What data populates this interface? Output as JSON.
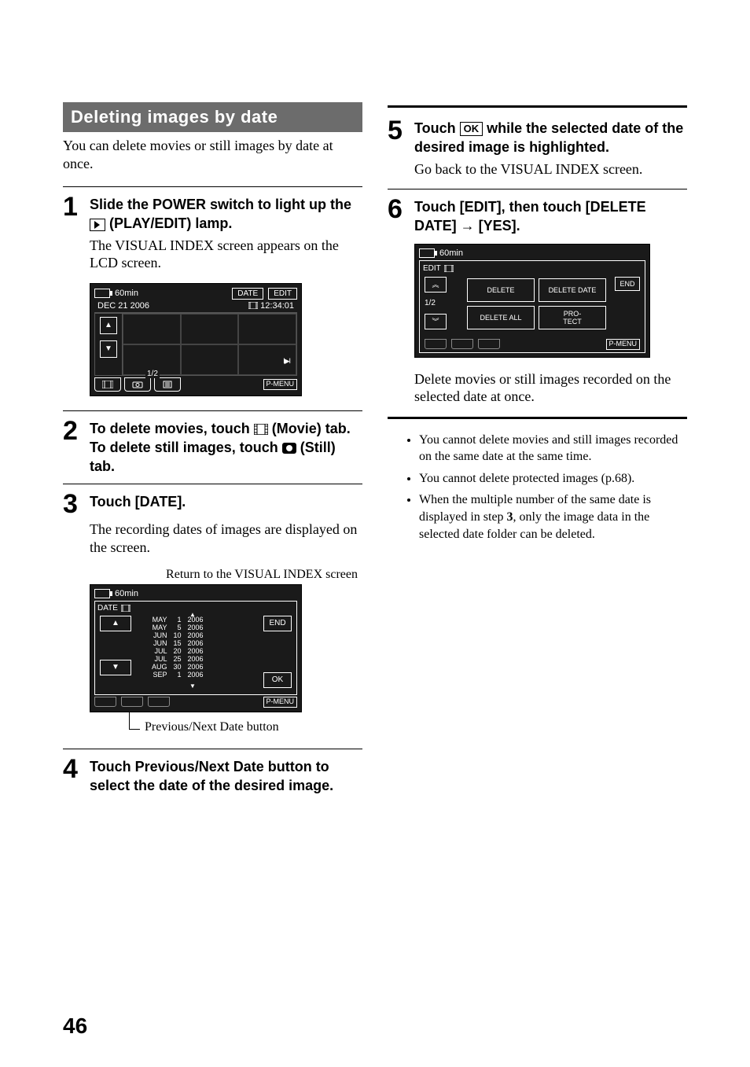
{
  "page_number": "46",
  "section_title": "Deleting images by date",
  "lead": "You can delete movies or still images by date at once.",
  "steps": {
    "s1": {
      "num": "1",
      "title_a": "Slide the POWER switch to light up the ",
      "title_b": " (PLAY/EDIT) lamp.",
      "body": "The VISUAL INDEX screen appears on the LCD screen."
    },
    "s2": {
      "num": "2",
      "title_a": "To delete movies, touch ",
      "title_b": " (Movie) tab. To delete still images, touch ",
      "title_c": " (Still) tab."
    },
    "s3": {
      "num": "3",
      "title": "Touch [DATE].",
      "body": "The recording dates of images are displayed on the screen.",
      "caption_top": "Return to the VISUAL INDEX screen",
      "caption_bottom": "Previous/Next Date button"
    },
    "s4": {
      "num": "4",
      "title": "Touch Previous/Next Date button to select the date of the desired image."
    },
    "s5": {
      "num": "5",
      "title_a": "Touch ",
      "title_b": " while the selected date of the desired image is highlighted.",
      "body": "Go back to the VISUAL INDEX screen."
    },
    "s6": {
      "num": "6",
      "title": "Touch [EDIT], then touch [DELETE DATE] → [YES].",
      "body": "Delete movies or still images recorded on the selected date at once."
    }
  },
  "notes": [
    "You cannot delete movies and still images recorded on the same date at the same time.",
    "You cannot delete protected images (p.68).",
    "When the multiple number of the same date is displayed in step 3, only the image data in the selected date folder can be deleted."
  ],
  "note_bold": "3",
  "lcd1": {
    "batt_time": "60min",
    "btn_date": "DATE",
    "btn_edit": "EDIT",
    "date": "DEC  21  2006",
    "time": "12:34:01",
    "counter": "1/2",
    "pmenu": "P-MENU",
    "play": "I▶I"
  },
  "lcd2": {
    "batt_time": "60min",
    "hdr": "DATE",
    "end": "END",
    "ok": "OK",
    "pmenu": "P-MENU",
    "dates": [
      [
        "MAY",
        "1",
        "2006"
      ],
      [
        "MAY",
        "5",
        "2006"
      ],
      [
        "JUN",
        "10",
        "2006"
      ],
      [
        "JUN",
        "15",
        "2006"
      ],
      [
        "JUL",
        "20",
        "2006"
      ],
      [
        "JUL",
        "25",
        "2006"
      ],
      [
        "AUG",
        "30",
        "2006"
      ],
      [
        "SEP",
        "1",
        "2006"
      ]
    ]
  },
  "lcd3": {
    "batt_time": "60min",
    "hdr": "EDIT",
    "page": "1/2",
    "end": "END",
    "pmenu": "P-MENU",
    "btns": [
      "DELETE",
      "DELETE DATE",
      "DELETE ALL",
      "PRO-\nTECT"
    ]
  },
  "ok_key": "OK"
}
